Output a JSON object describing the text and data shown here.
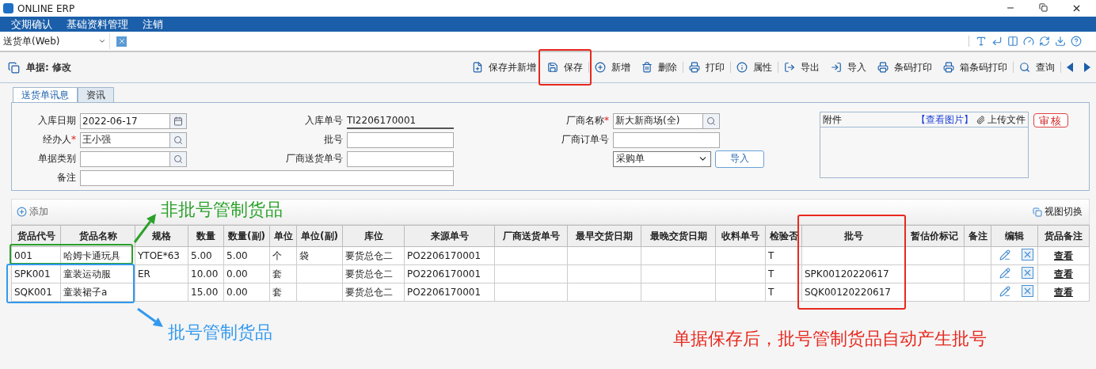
{
  "window": {
    "title": "ONLINE ERP"
  },
  "menu": [
    "交期确认",
    "基础资料管理",
    "注销"
  ],
  "doc_tab": {
    "label": "送货单(Web)"
  },
  "header": {
    "title": "单据: 修改"
  },
  "toolbar": [
    {
      "kind": "save-new",
      "label": "保存并新增"
    },
    {
      "kind": "save",
      "label": "保存"
    },
    {
      "kind": "add",
      "label": "新增"
    },
    {
      "kind": "delete",
      "label": "删除"
    },
    {
      "kind": "print",
      "label": "打印"
    },
    {
      "kind": "info",
      "label": "属性"
    },
    {
      "kind": "export",
      "label": "导出"
    },
    {
      "kind": "import",
      "label": "导入"
    },
    {
      "kind": "print",
      "label": "条码打印"
    },
    {
      "kind": "print",
      "label": "箱条码打印"
    },
    {
      "kind": "search",
      "label": "查询"
    }
  ],
  "form_tabs": [
    {
      "label": "送货单讯息",
      "selected": true
    },
    {
      "label": "资讯",
      "selected": false
    }
  ],
  "form": {
    "left": [
      {
        "label": "入库日期",
        "value": "2022-06-17",
        "kind": "date"
      },
      {
        "label": "经办人",
        "required_mark": "*",
        "value": "王小强",
        "kind": "lookup"
      },
      {
        "label": "单据类别",
        "kind": "lookup"
      },
      {
        "label": "备注",
        "kind": "wide"
      }
    ],
    "middle": [
      {
        "label": "入库单号",
        "value": "TI2206170001",
        "kind": "readonly"
      },
      {
        "label": "批号",
        "kind": "text"
      },
      {
        "label": "厂商送货单号",
        "kind": "text"
      }
    ],
    "right": [
      {
        "label": "厂商名称",
        "required_mark": "*",
        "value": "新大新商场(全)",
        "kind": "lookup"
      },
      {
        "label": "厂商订单号",
        "kind": "text"
      }
    ],
    "order_type": {
      "value": "采购单"
    },
    "import_button": "导入"
  },
  "attachment": {
    "title": "附件",
    "view_link": "【查看图片】",
    "upload": "上传文件",
    "audit_button": "审核"
  },
  "grid": {
    "add": "添加",
    "view_switch": "视图切换",
    "columns": [
      "货品代号",
      "货品名称",
      "规格",
      "数量",
      "数量(副)",
      "单位",
      "单位(副)",
      "库位",
      "来源单号",
      "厂商送货单号",
      "最早交货日期",
      "最晚交货日期",
      "收料单号",
      "检验否",
      "批号",
      "暂估价标记",
      "备注",
      "编辑",
      "货品备注"
    ],
    "rows": [
      {
        "cells": [
          "001",
          "哈姆卡通玩具",
          "YTOE*63",
          "5.00",
          "5.00",
          "个",
          "袋",
          "要货总仓二",
          "PO2206170001",
          "",
          "",
          "",
          "",
          "T",
          "",
          "",
          ""
        ],
        "note_link": "查看"
      },
      {
        "cells": [
          "SPK001",
          "童装运动服",
          "ER",
          "10.00",
          "0.00",
          "套",
          "",
          "要货总仓二",
          "PO2206170001",
          "",
          "",
          "",
          "",
          "T",
          "SPK00120220617",
          "",
          ""
        ],
        "note_link": "查看"
      },
      {
        "cells": [
          "SQK001",
          "童装裙子a",
          "",
          "15.00",
          "0.00",
          "套",
          "",
          "要货总仓二",
          "PO2206170001",
          "",
          "",
          "",
          "",
          "T",
          "SQK00120220617",
          "",
          ""
        ],
        "note_link": "查看"
      }
    ]
  },
  "annotations": [
    {
      "kind": "box",
      "color": "#e8281e"
    },
    {
      "kind": "box",
      "color": "#2aa12a"
    },
    {
      "kind": "arrow",
      "color": "#2aa12a"
    },
    {
      "kind": "label",
      "color": "#2aa12a",
      "text": "非批号管制货品"
    },
    {
      "kind": "box",
      "color": "#3399ee"
    },
    {
      "kind": "arrow",
      "color": "#3399ee"
    },
    {
      "kind": "label",
      "color": "#3399ee",
      "text": "批号管制货品"
    },
    {
      "kind": "box",
      "color": "#e8281e"
    },
    {
      "kind": "label",
      "color": "#e8281e",
      "text": "单据保存后，批号管制货品自动产生批号"
    }
  ]
}
